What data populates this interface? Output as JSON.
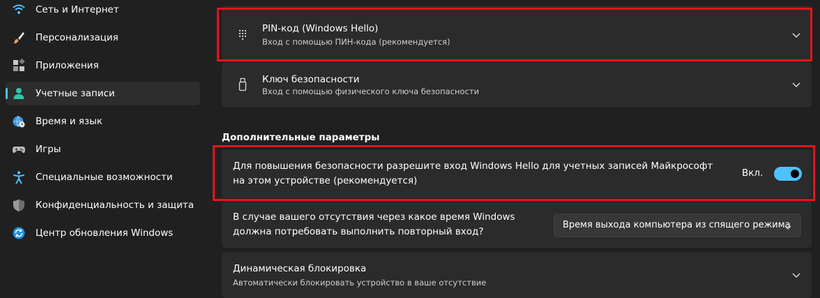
{
  "sidebar": {
    "items": [
      {
        "label": "Сеть и Интернет",
        "icon": "wifi-icon"
      },
      {
        "label": "Персонализация",
        "icon": "brush-icon"
      },
      {
        "label": "Приложения",
        "icon": "apps-icon"
      },
      {
        "label": "Учетные записи",
        "icon": "person-icon",
        "active": true
      },
      {
        "label": "Время и язык",
        "icon": "globe-clock-icon"
      },
      {
        "label": "Игры",
        "icon": "gamepad-icon"
      },
      {
        "label": "Специальные возможности",
        "icon": "accessibility-icon"
      },
      {
        "label": "Конфиденциальность и защита",
        "icon": "shield-icon"
      },
      {
        "label": "Центр обновления Windows",
        "icon": "update-icon"
      }
    ]
  },
  "main": {
    "pin": {
      "title": "PIN-код (Windows Hello)",
      "subtitle": "Вход с помощью ПИН-кода (рекомендуется)",
      "icon": "keypad-icon"
    },
    "security_key": {
      "title": "Ключ безопасности",
      "subtitle": "Вход с помощью физического ключа безопасности",
      "icon": "usb-key-icon"
    },
    "section_title": "Дополнительные параметры",
    "hello_only": {
      "text": "Для повышения безопасности разрешите вход Windows Hello для учетных записей Майкрософт на этом устройстве (рекомендуется)",
      "toggle_label": "Вкл.",
      "toggle_on": true
    },
    "signin_required": {
      "text": "В случае вашего отсутствия через какое время Windows должна потребовать выполнить повторный вход?",
      "dropdown_value": "Время выхода компьютера из спящего режима"
    },
    "dynamic_lock": {
      "title": "Динамическая блокировка",
      "subtitle": "Автоматически блокировать устройство в ваше отсутствие"
    }
  },
  "colors": {
    "accent": "#4cc2ff",
    "highlight": "#e3141f",
    "card": "#2b2b2b",
    "background": "#202020"
  }
}
